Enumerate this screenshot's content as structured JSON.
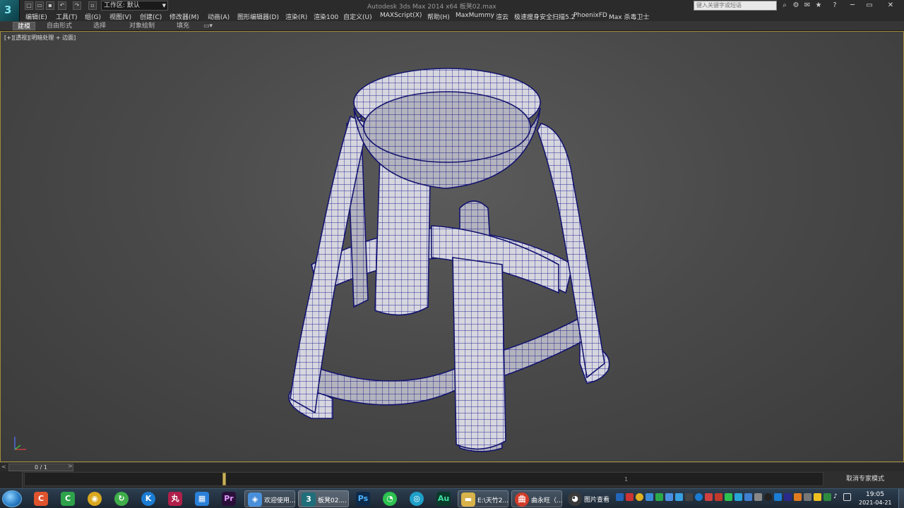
{
  "titlebar": {
    "window_title": "Autodesk 3ds Max  2014 x64     板凳02.max",
    "workspace": "工作区: 默认",
    "search_placeholder": "键入关键字或短语"
  },
  "menu": [
    "编辑(E)",
    "工具(T)",
    "组(G)",
    "视图(V)",
    "创建(C)",
    "修改器(M)",
    "动画(A)",
    "图形编辑器(D)",
    "渲染(R)",
    "渲染100",
    "自定义(U)",
    "MAXScript(X)",
    "帮助(H)",
    "MaxMummy",
    "渲云",
    "极速瘦身安全扫描5.2",
    "PhoenixFD",
    "Max 杀毒卫士"
  ],
  "ribbon": {
    "tabs": [
      "建模",
      "自由形式",
      "选择",
      "对象绘制",
      "填充"
    ],
    "active": "建模"
  },
  "viewport": {
    "label": "[+][透视][明暗处理 + 边面]"
  },
  "timeslider": {
    "frame": "0 / 1",
    "prev": "<",
    "next": ">"
  },
  "trackbar": {
    "end_tick": "1",
    "expert_mode": "取消专家模式"
  },
  "taskbar": {
    "apps": [
      {
        "label": "欢迎使用...",
        "color": "#4a8fd9"
      },
      {
        "label": "板凳02....",
        "color": "#1f6e7a"
      },
      {
        "label": "E:\\天竹2...",
        "color": "#d8b24a"
      },
      {
        "label": "曲永旺（...",
        "color": "#d23c2a"
      },
      {
        "label": "图片查看",
        "color": "#3a3a3a"
      }
    ],
    "time": "19:05",
    "date": "2021-04-21"
  }
}
